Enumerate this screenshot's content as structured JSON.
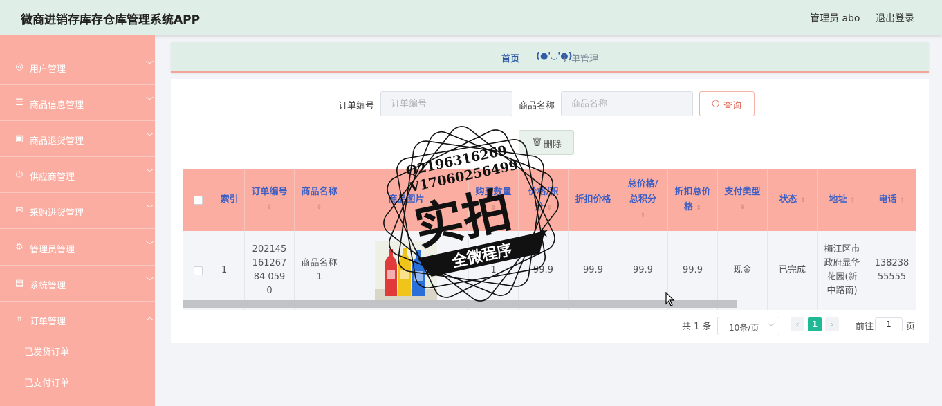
{
  "header": {
    "title": "微商进销存库存仓库管理系统APP",
    "admin": "管理员 abo",
    "logout": "退出登录"
  },
  "sidebar": {
    "items": [
      {
        "label": "用户管理",
        "icon": "user-circle-icon",
        "glyph": "◎",
        "expanded": false
      },
      {
        "label": "商品信息管理",
        "icon": "list-icon",
        "glyph": "☰",
        "expanded": false
      },
      {
        "label": "商品退货管理",
        "icon": "clipboard-icon",
        "glyph": "▣",
        "expanded": false
      },
      {
        "label": "供应商管理",
        "icon": "power-icon",
        "glyph": "⏻",
        "expanded": false
      },
      {
        "label": "采购进货管理",
        "icon": "mail-icon",
        "glyph": "✉",
        "expanded": false
      },
      {
        "label": "管理员管理",
        "icon": "settings-circle-icon",
        "glyph": "⚙",
        "expanded": false
      },
      {
        "label": "系统管理",
        "icon": "document-icon",
        "glyph": "▤",
        "expanded": false
      },
      {
        "label": "订单管理",
        "icon": "crop-icon",
        "glyph": "⌗",
        "expanded": true
      }
    ],
    "sub_items": [
      "已发货订单",
      "已支付订单"
    ]
  },
  "breadcrumb": {
    "home": "首页",
    "face": "(●'◡'●)",
    "current": "订单管理"
  },
  "search": {
    "order_no_label": "订单编号",
    "order_no_placeholder": "订单编号",
    "product_name_label": "商品名称",
    "product_name_placeholder": "商品名称",
    "search_button": "查询",
    "delete_button": "删除"
  },
  "table": {
    "headers": [
      "索引",
      "订单编号",
      "商品名称",
      "商品图片",
      "购买数量",
      "价格/积分",
      "折扣价格",
      "总价格/总积分",
      "折扣总价格",
      "支付类型",
      "状态",
      "地址",
      "电话"
    ],
    "rows": [
      {
        "index": "1",
        "order_no": "20214516126784 0590",
        "product_name": "商品名称1",
        "quantity": "1",
        "price": "99.9",
        "discount_price": "99.9",
        "total_price": "99.9",
        "discount_total": "99.9",
        "pay_type": "现金",
        "status": "已完成",
        "address": "梅江区市政府显华花园(新中路南)",
        "phone": "13823855555"
      }
    ]
  },
  "pagination": {
    "total": "共 1 条",
    "page_size": "10条/页",
    "current": "1",
    "goto": "前往",
    "goto_value": "1",
    "unit": "页"
  },
  "watermark": {
    "contact1": "Q2196316269",
    "contact2": "V17060256499",
    "main": "实拍",
    "sub": "全微程序"
  },
  "colors": {
    "sidebar": "#fbada1",
    "header": "#dfeee6",
    "table_header": "#fbada1",
    "header_text": "#3d5fc4",
    "accent": "#20b996"
  }
}
